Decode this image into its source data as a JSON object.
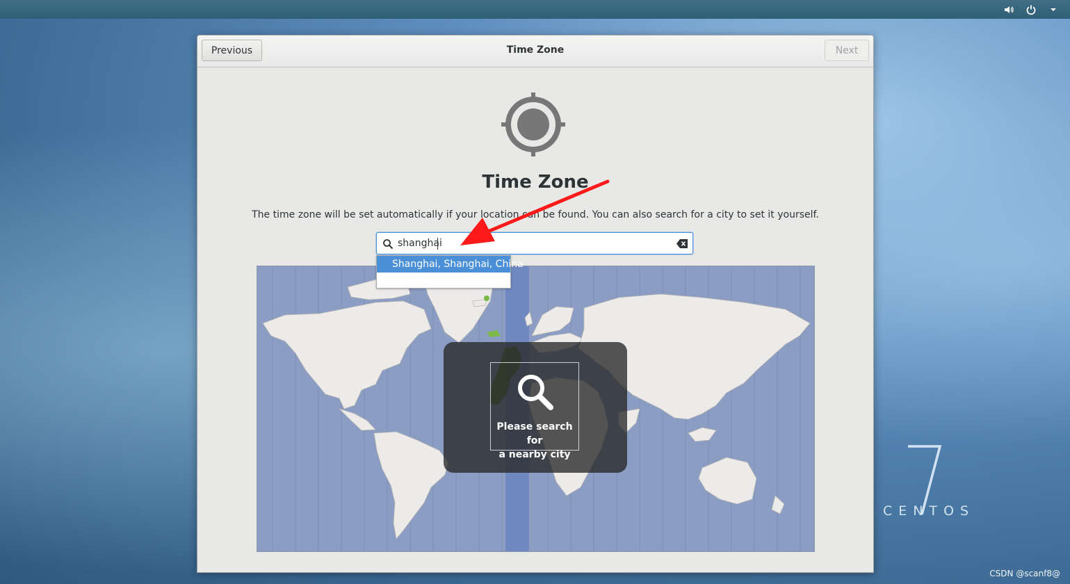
{
  "desktop": {
    "brand_number": "7",
    "brand_name": "CENTOS",
    "watermark": "CSDN @scanf8@"
  },
  "topbar": {
    "icons": [
      "volume-icon",
      "power-icon",
      "menu-arrow-icon"
    ]
  },
  "window": {
    "title": "Time Zone",
    "previous_label": "Previous",
    "next_label": "Next",
    "next_enabled": false
  },
  "main": {
    "heading": "Time Zone",
    "description": "The time zone will be set automatically if your location can be found. You can also search for a city to set it yourself.",
    "search": {
      "value": "shanghai",
      "placeholder": ""
    },
    "suggestions": [
      {
        "label": "Shanghai, Shanghai, China",
        "selected": true
      }
    ],
    "overlay_text_line1": "Please search for",
    "overlay_text_line2": "a nearby city"
  },
  "colors": {
    "accent": "#4a90d9",
    "map_ocean": "#8b9dc3",
    "map_land": "#ecebea",
    "map_highlight": "#4a6e2e",
    "overlay": "#282828"
  }
}
